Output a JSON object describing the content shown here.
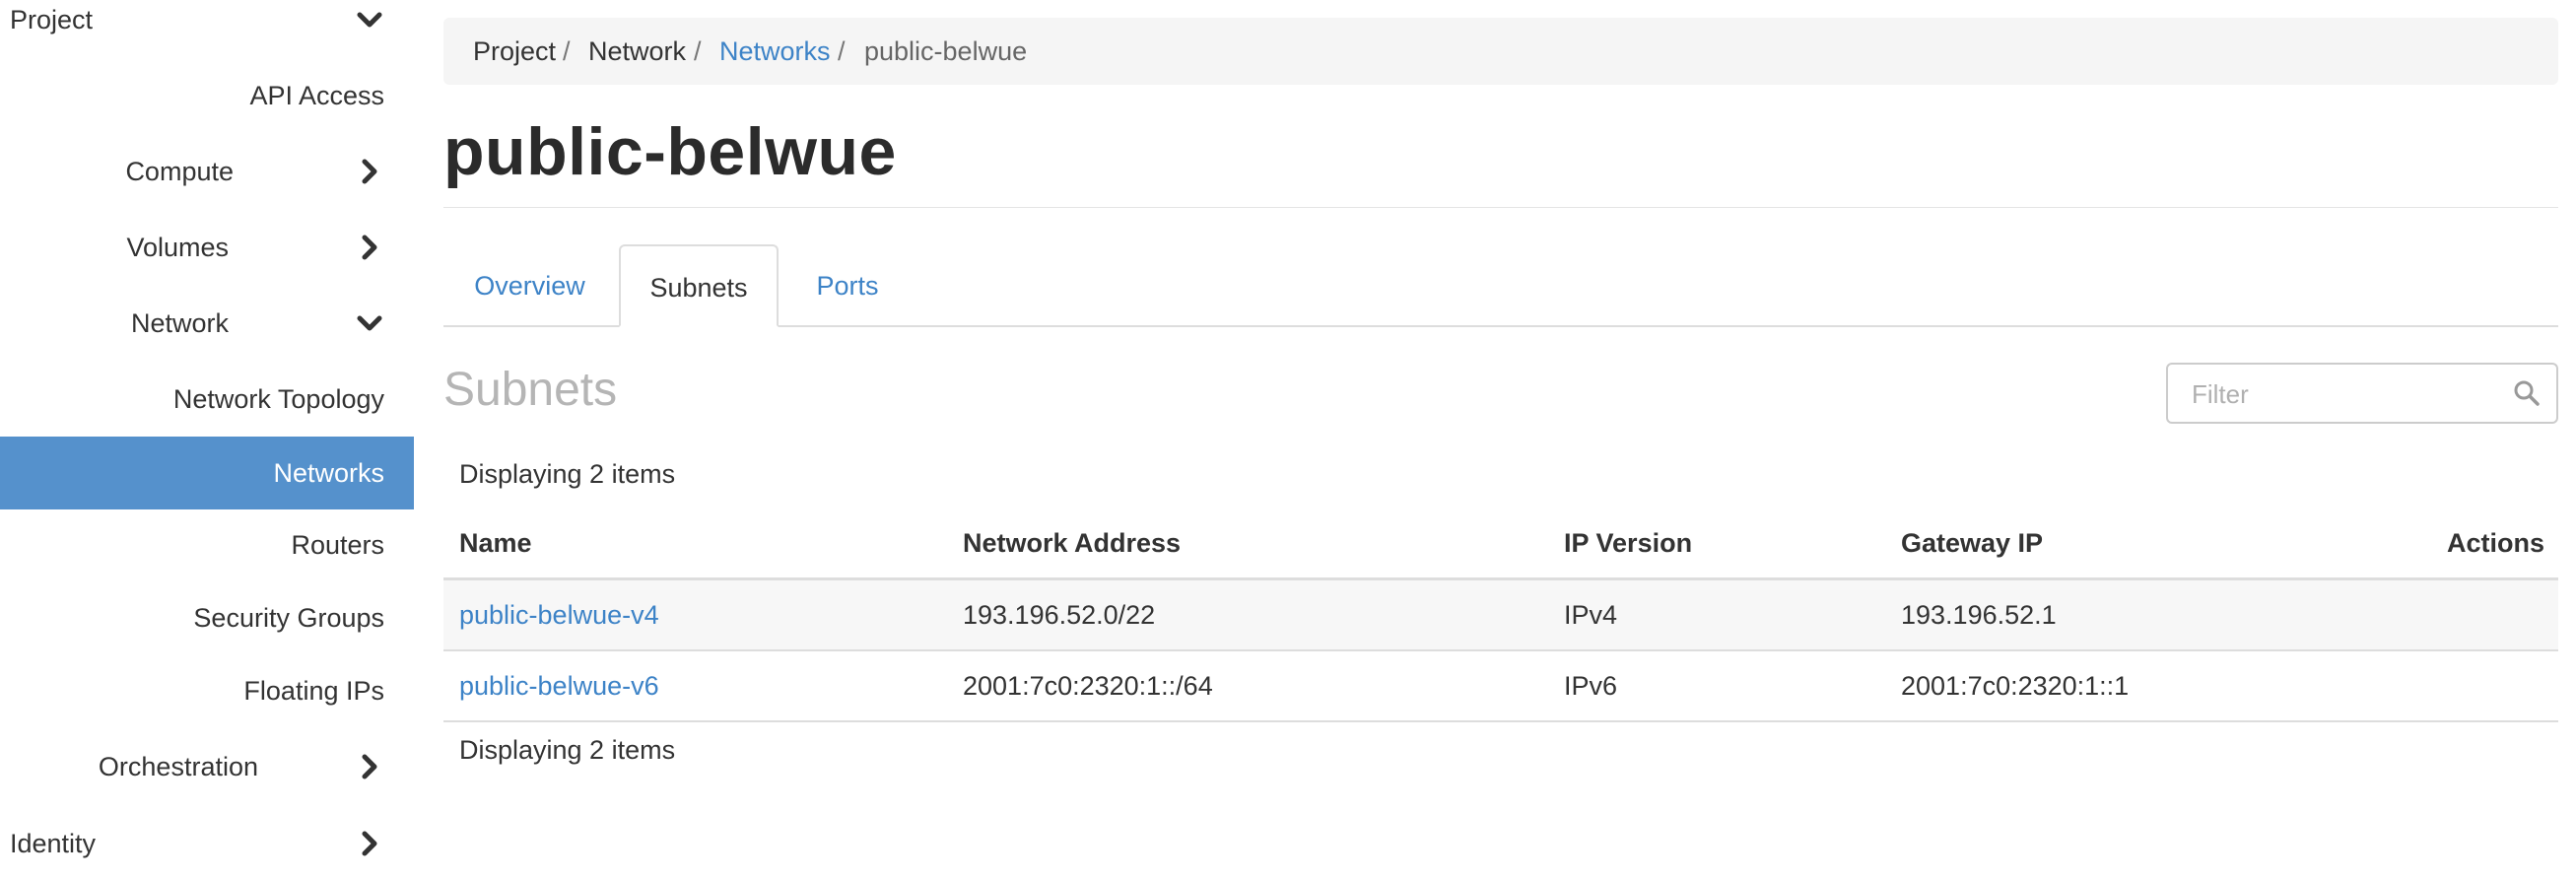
{
  "sidebar": {
    "items": [
      {
        "label": "Project",
        "icon": "chevron-down-icon"
      },
      {
        "label": "API Access"
      },
      {
        "label": "Compute",
        "icon": "chevron-right-icon"
      },
      {
        "label": "Volumes",
        "icon": "chevron-right-icon"
      },
      {
        "label": "Network",
        "icon": "chevron-down-icon"
      },
      {
        "label": "Network Topology"
      },
      {
        "label": "Networks",
        "active": true
      },
      {
        "label": "Routers"
      },
      {
        "label": "Security Groups"
      },
      {
        "label": "Floating IPs"
      },
      {
        "label": "Orchestration",
        "icon": "chevron-right-icon"
      },
      {
        "label": "Identity",
        "icon": "chevron-right-icon"
      }
    ],
    "active_color": "#5591cc"
  },
  "breadcrumb": {
    "project": "Project",
    "network": "Network",
    "networks": "Networks",
    "current": "public-belwue",
    "separator": "/"
  },
  "page": {
    "title": "public-belwue"
  },
  "tabs": [
    {
      "label": "Overview"
    },
    {
      "label": "Subnets",
      "active": true
    },
    {
      "label": "Ports"
    }
  ],
  "subnets": {
    "title": "Subnets",
    "filter_placeholder": "Filter",
    "count_top": "Displaying 2 items",
    "count_bottom": "Displaying 2 items",
    "columns": {
      "name": "Name",
      "network_address": "Network Address",
      "ip_version": "IP Version",
      "gateway_ip": "Gateway IP",
      "actions": "Actions"
    },
    "rows": [
      {
        "name": "public-belwue-v4",
        "network_address": "193.196.52.0/22",
        "ip_version": "IPv4",
        "gateway_ip": "193.196.52.1"
      },
      {
        "name": "public-belwue-v6",
        "network_address": "2001:7c0:2320:1::/64",
        "ip_version": "IPv6",
        "gateway_ip": "2001:7c0:2320:1::1"
      }
    ]
  },
  "colors": {
    "link": "#3d83c7",
    "accent": "#5591cc"
  }
}
